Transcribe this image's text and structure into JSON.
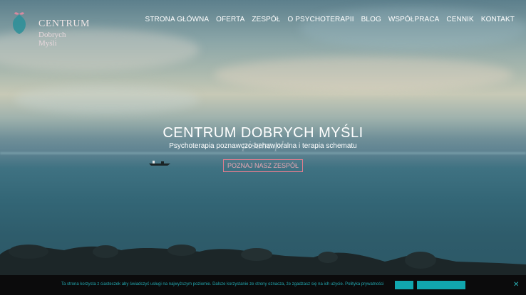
{
  "site": {
    "logo": {
      "title": "CENTRUM",
      "subtitle": "Dobrych Myśli"
    },
    "nav": [
      "STRONA GŁÓWNA",
      "OFERTA",
      "ZESPÓŁ",
      "O PSYCHOTERAPII",
      "BLOG",
      "WSPÓŁPRACA",
      "CENNIK",
      "KONTAKT"
    ]
  },
  "hero": {
    "title": "CENTRUM DOBRYCH MYŚLI",
    "subtitle": "Psychoterapia poznawczo-behawioralna i terapia schematu",
    "watermark": "pisane.pl",
    "cta": "POZNAJ NASZ ZESPÓŁ"
  },
  "cookie": {
    "text": "Ta strona korzysta z ciasteczek aby świadczyć usługi na najwyższym poziomie. Dalsze korzystanie ze strony oznacza, że zgadzasz się na ich użycie. Polityka prywatności",
    "close": "✕"
  },
  "colors": {
    "accent": "#e07d8e",
    "cookie_accent": "#11a6ae",
    "cookie_bg": "#0b0b0c"
  }
}
